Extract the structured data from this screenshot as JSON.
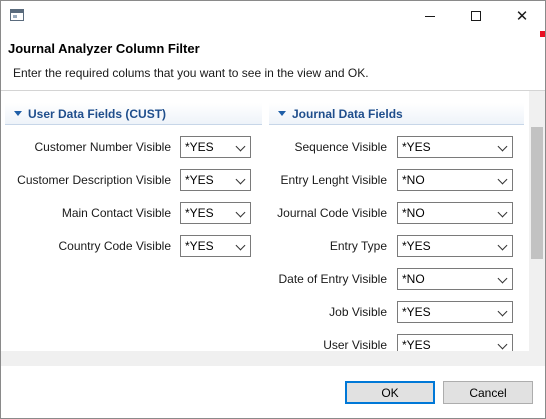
{
  "window": {
    "title_icon": "window-app-icon",
    "controls": {
      "minimize": "minimize-icon",
      "maximize": "maximize-icon",
      "close": "close-icon",
      "close_glyph": "✕"
    }
  },
  "dialog": {
    "title": "Journal Analyzer Column Filter",
    "message": "Enter the required colums that you want to see in the view and OK."
  },
  "sections": {
    "left": {
      "title": "User Data Fields (CUST)",
      "fields": [
        {
          "label": "Customer Number Visible",
          "value": "*YES"
        },
        {
          "label": "Customer Description Visible",
          "value": "*YES"
        },
        {
          "label": "Main Contact Visible",
          "value": "*YES"
        },
        {
          "label": "Country Code Visible",
          "value": "*YES"
        }
      ]
    },
    "right": {
      "title": "Journal Data Fields",
      "fields": [
        {
          "label": "Sequence Visible",
          "value": "*YES"
        },
        {
          "label": "Entry Lenght Visible",
          "value": "*NO"
        },
        {
          "label": "Journal Code Visible",
          "value": "*NO"
        },
        {
          "label": "Entry Type",
          "value": "*YES"
        },
        {
          "label": "Date of Entry Visible",
          "value": "*NO"
        },
        {
          "label": "Job Visible",
          "value": "*YES"
        },
        {
          "label": "User Visible",
          "value": "*YES"
        }
      ]
    }
  },
  "buttons": {
    "ok": "OK",
    "cancel": "Cancel"
  },
  "colors": {
    "section_title": "#1f4e8c",
    "default_button_border": "#0078d7",
    "close_accent": "#e81123"
  }
}
